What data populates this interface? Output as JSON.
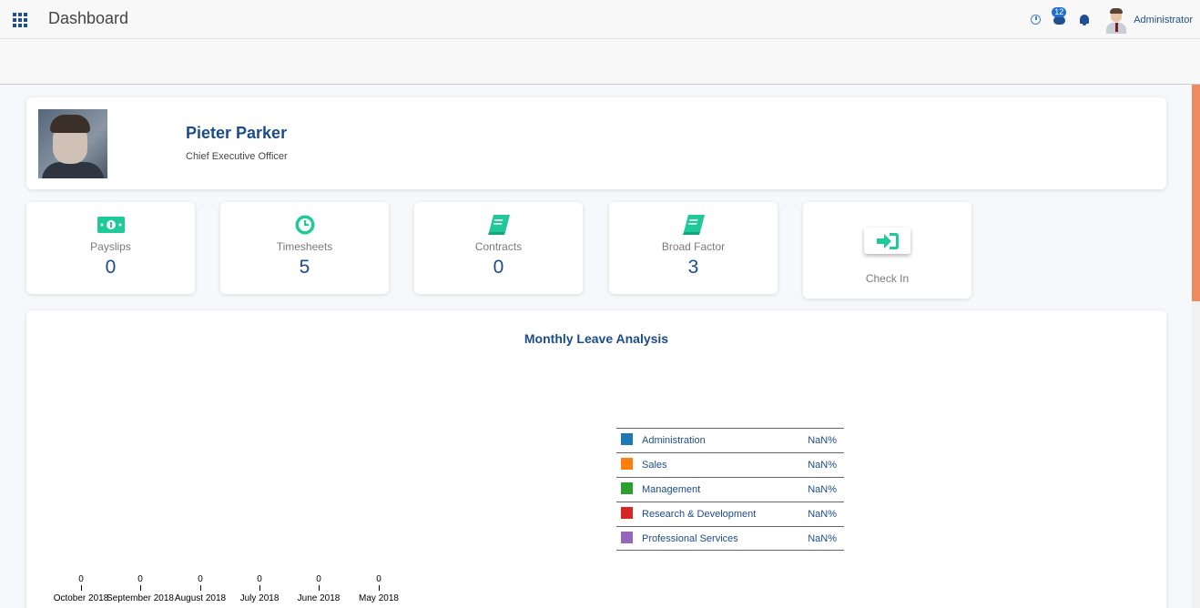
{
  "header": {
    "title": "Dashboard",
    "chat_badge": "12",
    "user_name": "Administrator"
  },
  "profile": {
    "name": "Pieter Parker",
    "role": "Chief Executive Officer"
  },
  "stats": [
    {
      "label": "Payslips",
      "value": "0",
      "icon": "money-icon"
    },
    {
      "label": "Timesheets",
      "value": "5",
      "icon": "clock-icon"
    },
    {
      "label": "Contracts",
      "value": "0",
      "icon": "book-icon"
    },
    {
      "label": "Broad Factor",
      "value": "3",
      "icon": "book-icon"
    }
  ],
  "checkin": {
    "label": "Check In",
    "icon": "sign-in-icon"
  },
  "colors": {
    "accent": "#1c4b8c",
    "icon_green": "#1fc99a",
    "scrollbar": "#ee8a5e"
  },
  "chart_data": {
    "type": "bar",
    "title": "Monthly Leave Analysis",
    "categories": [
      "October 2018",
      "September 2018",
      "August 2018",
      "July 2018",
      "June 2018",
      "May 2018"
    ],
    "values": [
      0,
      0,
      0,
      0,
      0,
      0
    ],
    "value_labels": [
      "0",
      "0",
      "0",
      "0",
      "0",
      "0"
    ],
    "legend": [
      {
        "name": "Administration",
        "value": "NaN%",
        "color": "#1f77b4"
      },
      {
        "name": "Sales",
        "value": "NaN%",
        "color": "#ff7f0e"
      },
      {
        "name": "Management",
        "value": "NaN%",
        "color": "#2ca02c"
      },
      {
        "name": "Research & Development",
        "value": "NaN%",
        "color": "#d62728"
      },
      {
        "name": "Professional Services",
        "value": "NaN%",
        "color": "#9467bd"
      }
    ]
  }
}
